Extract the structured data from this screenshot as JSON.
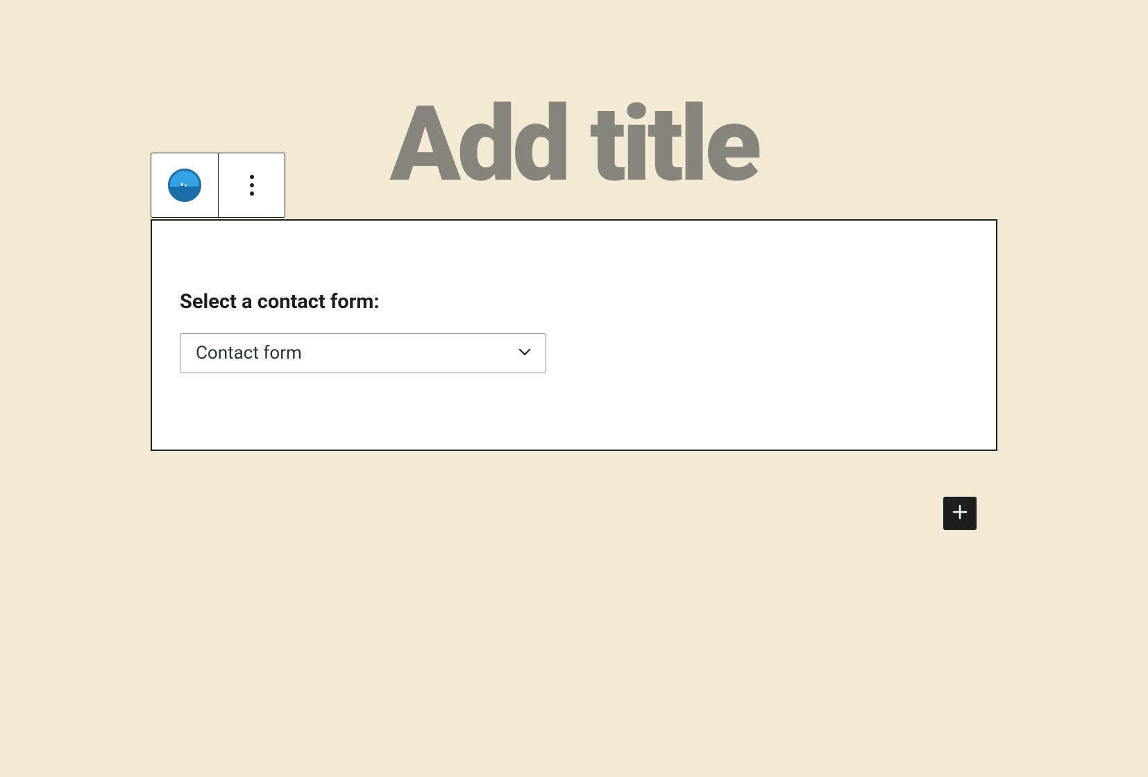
{
  "editor": {
    "title_placeholder": "Add title"
  },
  "block": {
    "label": "Select a contact form:",
    "select": {
      "selected_value": "Contact form",
      "options": [
        "Contact form"
      ]
    }
  },
  "icons": {
    "block_icon": "mountain-icon",
    "more": "vertical-ellipsis-icon",
    "add": "plus-icon",
    "chevron": "chevron-down-icon"
  }
}
